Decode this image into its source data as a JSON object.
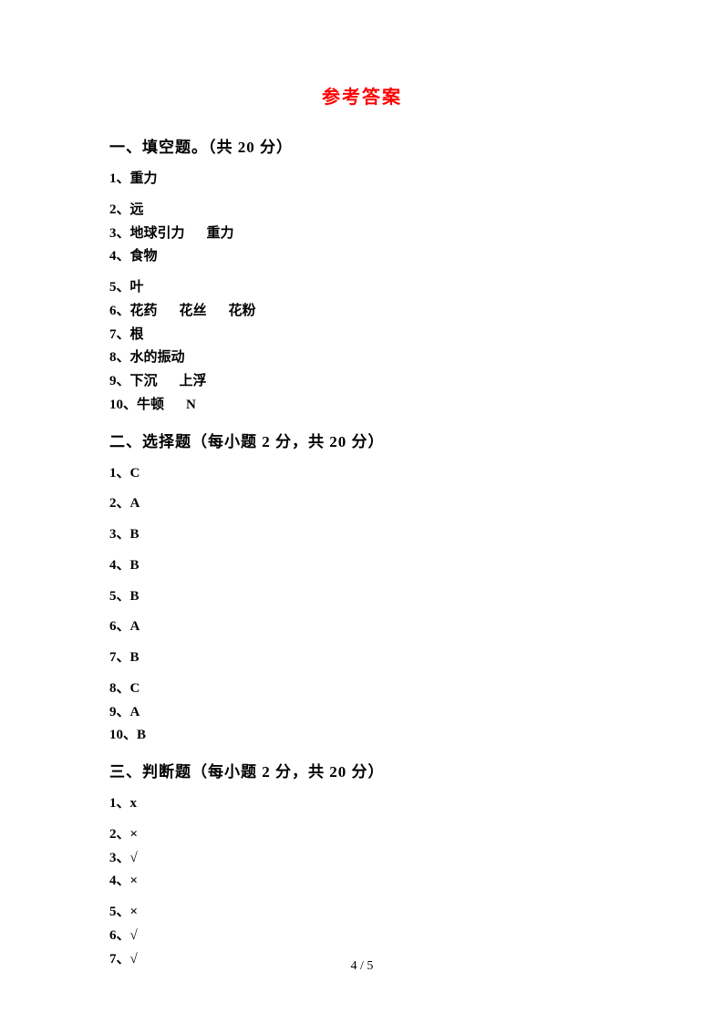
{
  "title": "参考答案",
  "sections": [
    {
      "heading": "一、填空题。（共 20 分）",
      "items": [
        {
          "num": "1",
          "text": "重力",
          "spaced": true
        },
        {
          "num": "2",
          "text": "远",
          "spaced": false
        },
        {
          "num": "3",
          "text": "地球引力     重力",
          "spaced": false
        },
        {
          "num": "4",
          "text": "食物",
          "spaced": true
        },
        {
          "num": "5",
          "text": "叶",
          "spaced": false
        },
        {
          "num": "6",
          "text": "花药     花丝     花粉",
          "spaced": false
        },
        {
          "num": "7",
          "text": "根",
          "spaced": false
        },
        {
          "num": "8",
          "text": "水的振动",
          "spaced": false
        },
        {
          "num": "9",
          "text": "下沉     上浮",
          "spaced": false
        },
        {
          "num": "10",
          "text": "牛顿     N",
          "spaced": false
        }
      ]
    },
    {
      "heading": "二、选择题（每小题 2 分，共 20 分）",
      "items": [
        {
          "num": "1",
          "text": "C",
          "spaced": true
        },
        {
          "num": "2",
          "text": "A",
          "spaced": true
        },
        {
          "num": "3",
          "text": "B",
          "spaced": true
        },
        {
          "num": "4",
          "text": "B",
          "spaced": true
        },
        {
          "num": "5",
          "text": "B",
          "spaced": true
        },
        {
          "num": "6",
          "text": "A",
          "spaced": true
        },
        {
          "num": "7",
          "text": "B",
          "spaced": true
        },
        {
          "num": "8",
          "text": "C",
          "spaced": false
        },
        {
          "num": "9",
          "text": "A",
          "spaced": false
        },
        {
          "num": "10",
          "text": "B",
          "spaced": false
        }
      ]
    },
    {
      "heading": "三、判断题（每小题 2 分，共 20 分）",
      "items": [
        {
          "num": "1",
          "text": "x",
          "spaced": true
        },
        {
          "num": "2",
          "text": "×",
          "spaced": false
        },
        {
          "num": "3",
          "text": "√",
          "spaced": false
        },
        {
          "num": "4",
          "text": "×",
          "spaced": true
        },
        {
          "num": "5",
          "text": "×",
          "spaced": false
        },
        {
          "num": "6",
          "text": "√",
          "spaced": false
        },
        {
          "num": "7",
          "text": "√",
          "spaced": false
        }
      ]
    }
  ],
  "pageNumber": "4 / 5"
}
